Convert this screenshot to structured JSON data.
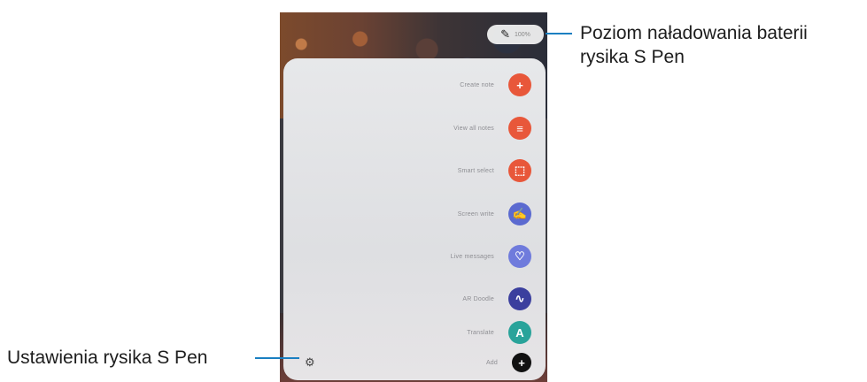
{
  "battery": {
    "percent_label": "100%",
    "pen_glyph": "✎"
  },
  "menu": {
    "items": [
      {
        "label": "Create note",
        "icon": "plus-note-icon",
        "color": "#e8573a",
        "glyph": "+"
      },
      {
        "label": "View all notes",
        "icon": "notes-icon",
        "color": "#e8573a",
        "glyph": "≡"
      },
      {
        "label": "Smart select",
        "icon": "smart-select-icon",
        "color": "#e8573a",
        "glyph": "⬚"
      },
      {
        "label": "Screen write",
        "icon": "screen-write-icon",
        "color": "#5b6ad0",
        "glyph": "✍"
      },
      {
        "label": "Live messages",
        "icon": "heart-message-icon",
        "color": "#6f7bdc",
        "glyph": "♡"
      },
      {
        "label": "AR Doodle",
        "icon": "ar-doodle-icon",
        "color": "#3b3f9e",
        "glyph": "∿"
      },
      {
        "label": "Translate",
        "icon": "translate-icon",
        "color": "#29a39a",
        "glyph": "A"
      },
      {
        "label": "Add",
        "icon": "add-icon",
        "color": "#111111",
        "glyph": "+"
      }
    ],
    "settings_glyph": "⚙"
  },
  "callouts": {
    "battery_line1": "Poziom naładowania baterii",
    "battery_line2": "rysika S Pen",
    "settings": "Ustawienia rysika S Pen"
  }
}
